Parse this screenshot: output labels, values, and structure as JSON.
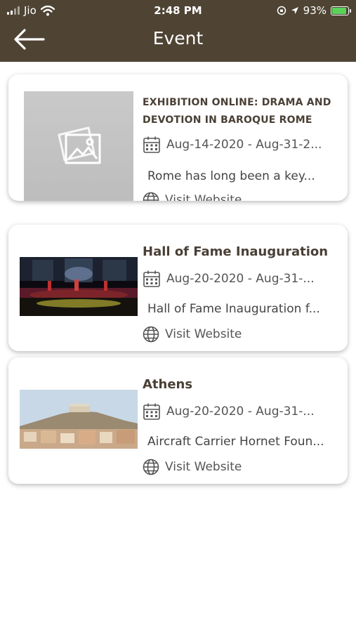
{
  "status_bar": {
    "carrier": "Jio",
    "time": "2:48 PM",
    "battery": "93%",
    "battery_level": 0.93
  },
  "header": {
    "title": "Event"
  },
  "colors": {
    "header": "#4f4434",
    "card_title": "#4a4036",
    "battery_fill": "#5bd35b"
  },
  "events": [
    {
      "title": "EXHIBITION ONLINE: DRAMA AND DEVOTION IN BAROQUE ROME",
      "dates": "Aug-14-2020 - Aug-31-2...",
      "description": "Rome has long been a key...",
      "link_label": "Visit Website",
      "image": "placeholder-image-icon"
    },
    {
      "title": "Hall of Fame Inauguration",
      "dates": "Aug-20-2020 - Aug-31-...",
      "description": "Hall of Fame Inauguration f...",
      "link_label": "Visit Website",
      "image": "concert-stage-photo"
    },
    {
      "title": "Athens",
      "dates": "Aug-20-2020 - Aug-31-...",
      "description": "Aircraft Carrier Hornet Foun...",
      "link_label": "Visit Website",
      "image": "athens-city-photo"
    }
  ]
}
